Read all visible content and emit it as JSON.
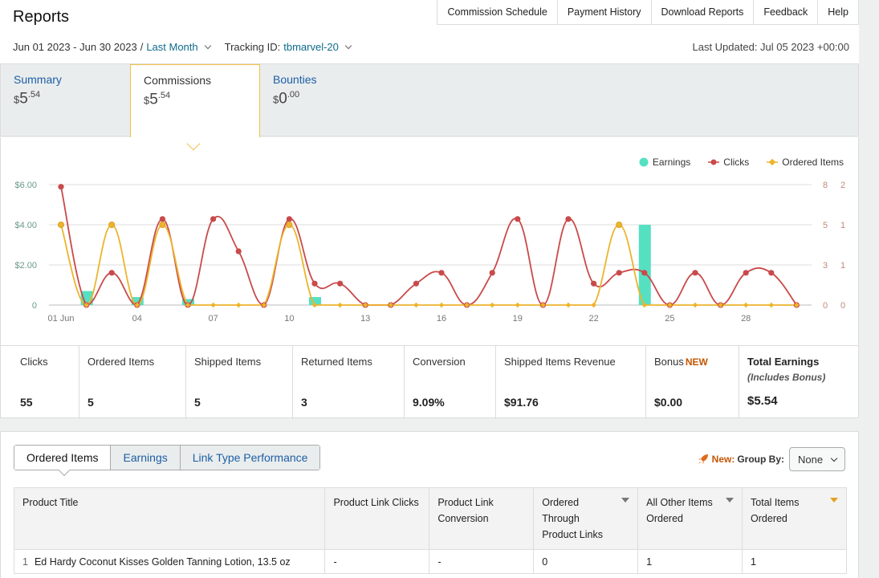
{
  "header": {
    "title": "Reports",
    "nav": [
      "Commission Schedule",
      "Payment History",
      "Download Reports",
      "Feedback",
      "Help"
    ],
    "date_range": "Jun 01 2023 - Jun 30 2023",
    "date_sep": "/",
    "period": "Last Month",
    "tracking_label": "Tracking ID:",
    "tracking_id": "tbmarvel-20",
    "last_updated": "Last Updated: Jul 05 2023 +00:00"
  },
  "tabs": [
    {
      "label": "Summary",
      "currency": "$",
      "whole": "5",
      "cents": ".54"
    },
    {
      "label": "Commissions",
      "currency": "$",
      "whole": "5",
      "cents": ".54"
    },
    {
      "label": "Bounties",
      "currency": "$",
      "whole": "0",
      "cents": ".00"
    }
  ],
  "active_tab": "Commissions",
  "chart_data": {
    "type": "line",
    "legend": [
      "Earnings",
      "Clicks",
      "Ordered Items"
    ],
    "colors": {
      "earnings": "#56e0c2",
      "clicks": "#c94a4a",
      "ordered": "#ecb42c",
      "axis_left": "#6a9a8a",
      "axis_right": "#c08a7a"
    },
    "x": [
      1,
      2,
      3,
      4,
      5,
      6,
      7,
      8,
      9,
      10,
      11,
      12,
      13,
      14,
      15,
      16,
      17,
      18,
      19,
      20,
      21,
      22,
      23,
      24,
      25,
      26,
      27,
      28,
      29,
      30
    ],
    "x_tick_labels": [
      "01 Jun",
      "04",
      "07",
      "10",
      "13",
      "16",
      "19",
      "22",
      "25",
      "28"
    ],
    "x_tick_days": [
      1,
      4,
      7,
      10,
      13,
      16,
      19,
      22,
      25,
      28
    ],
    "left_axis": {
      "ticks": [
        "0",
        "$2.00",
        "$4.00",
        "$6.00"
      ],
      "ylim": [
        0,
        6
      ]
    },
    "right_axis_clicks": {
      "ticks": [
        "0",
        "3",
        "5",
        "8"
      ],
      "ylim": [
        0,
        8
      ]
    },
    "right_axis_items": {
      "ticks": [
        "0",
        "1",
        "1",
        "2"
      ],
      "ylim": [
        0,
        2
      ]
    },
    "grid": true,
    "series": [
      {
        "name": "Earnings",
        "kind": "bar",
        "axis": "left",
        "values": [
          0,
          0.7,
          0,
          0.4,
          0,
          0.3,
          0,
          0,
          0,
          0,
          0.4,
          0,
          0,
          0,
          0,
          0,
          0,
          0,
          0,
          0,
          0,
          0,
          0,
          4.0,
          0,
          0,
          0,
          0,
          0,
          0
        ]
      },
      {
        "name": "Clicks",
        "kind": "line",
        "axis": "right_clicks",
        "values": [
          11,
          0,
          3,
          0,
          8,
          0,
          8,
          5,
          0,
          8,
          2,
          2,
          0,
          0,
          2,
          3,
          0,
          3,
          8,
          0,
          8,
          2,
          3,
          3,
          0,
          3,
          0,
          3,
          3,
          0
        ]
      },
      {
        "name": "Ordered Items",
        "kind": "line",
        "axis": "right_items",
        "values": [
          1,
          0,
          1,
          0,
          1,
          0,
          0,
          0,
          0,
          1,
          0,
          0,
          0,
          0,
          0,
          0,
          0,
          0,
          0,
          0,
          0,
          0,
          1,
          0,
          0,
          0,
          0,
          0,
          0,
          0
        ]
      }
    ]
  },
  "stats": [
    {
      "label": "Clicks",
      "value": "55"
    },
    {
      "label": "Ordered Items",
      "value": "5"
    },
    {
      "label": "Shipped Items",
      "value": "5"
    },
    {
      "label": "Returned Items",
      "value": "3"
    },
    {
      "label": "Conversion",
      "value": "9.09%"
    },
    {
      "label": "Shipped Items Revenue",
      "value": "$91.76"
    },
    {
      "label": "Bonus",
      "new": "NEW",
      "value": "$0.00"
    },
    {
      "label": "Total Earnings",
      "sub": "(Includes Bonus)",
      "value": "$5.54"
    }
  ],
  "bottom": {
    "segments": [
      "Ordered Items",
      "Earnings",
      "Link Type Performance"
    ],
    "new_label": "New:",
    "group_by_label": "Group By:",
    "group_by_value": "None",
    "columns": [
      "Product Title",
      "Product Link Clicks",
      "Product Link Conversion",
      "Ordered Through Product Links",
      "All Other Items Ordered",
      "Total Items Ordered"
    ],
    "rows": [
      {
        "num": "1",
        "title": "Ed Hardy Coconut Kisses Golden Tanning Lotion, 13.5 oz",
        "clicks": "-",
        "conversion": "-",
        "ordered_links": "0",
        "other": "1",
        "total": "1"
      }
    ]
  }
}
